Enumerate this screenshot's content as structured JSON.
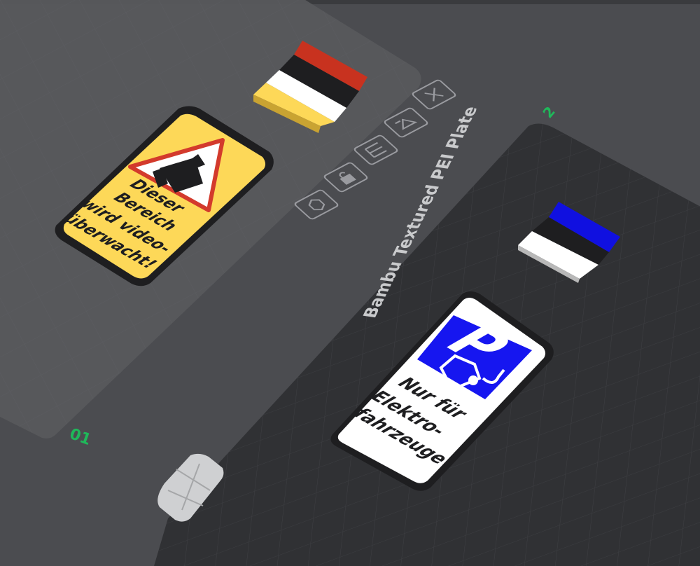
{
  "viewport": {
    "plate_name": "Bambu Textured PEI Plate",
    "plate_number": "01",
    "plate_number_2": "2",
    "colors": {
      "background": "#4b4c50",
      "plate_dark": "#303134",
      "plate_translucent": "#58595d",
      "accent_green": "#1fb85a",
      "icon_stroke": "#9a9ba0"
    }
  },
  "plate_toolbar": {
    "icons": [
      {
        "name": "close-plate-icon"
      },
      {
        "name": "edit-plate-icon"
      },
      {
        "name": "arrange-icon"
      },
      {
        "name": "lock-icon"
      },
      {
        "name": "orient-icon"
      }
    ]
  },
  "models": {
    "camera_sign": {
      "lines": [
        "Dieser",
        "Bereich",
        "wird video-",
        "überwacht!"
      ],
      "colors": {
        "base": "#f2c94c",
        "face": "#fdd858",
        "border": "#1e1e20",
        "triangle": "#d33a2c"
      }
    },
    "parking_sign": {
      "letter": "P",
      "lines": [
        "Nur für",
        "Elektro-",
        "fahrzeuge"
      ],
      "colors": {
        "face": "#ffffff",
        "blue": "#1616f0",
        "border": "#1e1e20"
      }
    },
    "flag_de": {
      "colors": [
        "#c8321f",
        "#1e1e20",
        "#ffffff",
        "#fdd858"
      ]
    },
    "flag_ee": {
      "colors": [
        "#1010e0",
        "#1e1e20",
        "#ffffff"
      ]
    }
  }
}
